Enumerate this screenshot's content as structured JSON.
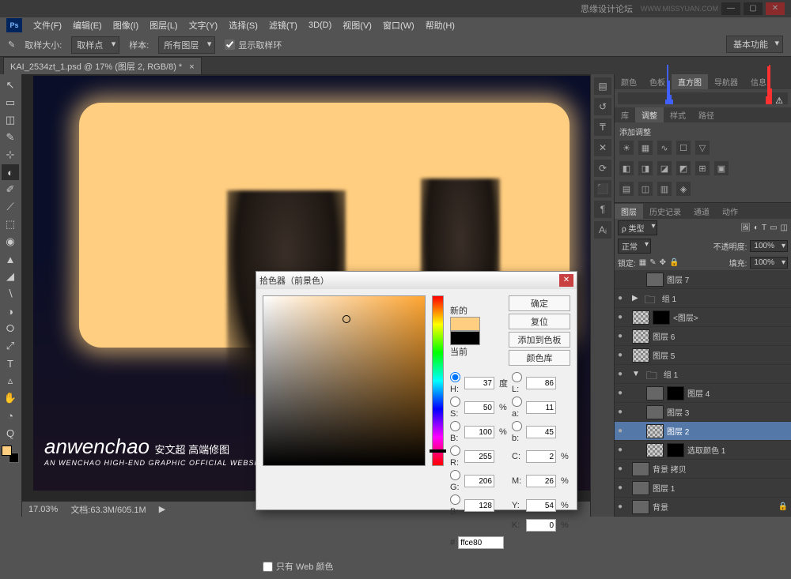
{
  "titlebar": {
    "brand": "思缘设计论坛",
    "url": "WWW.MISSYUAN.COM"
  },
  "menu": [
    "文件(F)",
    "编辑(E)",
    "图像(I)",
    "图层(L)",
    "文字(Y)",
    "选择(S)",
    "滤镜(T)",
    "3D(D)",
    "视图(V)",
    "窗口(W)",
    "帮助(H)"
  ],
  "options": {
    "sample_size_label": "取样大小:",
    "sample_size_value": "取样点",
    "sample_label": "样本:",
    "sample_value": "所有图层",
    "show_ring": "显示取样环"
  },
  "workspace": "基本功能",
  "doc_tab": "KAI_2534zt_1.psd @ 17% (图层 2, RGB/8) *",
  "status": {
    "zoom": "17.03%",
    "doc_info": "文档:63.3M/605.1M"
  },
  "watermark": {
    "big": "anwenchao",
    "cn": "安文超 高端修图",
    "sub": "AN WENCHAO HIGH-END GRAPHIC OFFICIAL WEBSITE/WWW.ANWENCHAO.COM"
  },
  "panels": {
    "tabs1": [
      "颜色",
      "色板",
      "直方图",
      "导航器",
      "信息"
    ],
    "tabs1_active": 2,
    "tabs2": [
      "库",
      "调整",
      "样式",
      "路径"
    ],
    "adjust_label": "添加调整",
    "tabs3": [
      "图层",
      "历史记录",
      "通道",
      "动作"
    ],
    "layer_kind": "ρ 类型",
    "blend_mode": "正常",
    "opacity_label": "不透明度:",
    "opacity_value": "100%",
    "lock_label": "锁定:",
    "fill_label": "填充:",
    "fill_value": "100%",
    "layers": [
      {
        "eye": "",
        "name": "图层 7",
        "indent": 1,
        "thumb": "img"
      },
      {
        "eye": "●",
        "name": "组 1",
        "indent": 0,
        "thumb": "folder",
        "arrow": "▶"
      },
      {
        "eye": "●",
        "name": "<图层>",
        "indent": 0,
        "thumb": "checker",
        "mask": true
      },
      {
        "eye": "●",
        "name": "图层 6",
        "indent": 0,
        "thumb": "checker"
      },
      {
        "eye": "●",
        "name": "图层 5",
        "indent": 0,
        "thumb": "checker"
      },
      {
        "eye": "●",
        "name": "组 1",
        "indent": 0,
        "thumb": "folder",
        "arrow": "▼"
      },
      {
        "eye": "●",
        "name": "图层 4",
        "indent": 1,
        "thumb": "img",
        "mask": true
      },
      {
        "eye": "●",
        "name": "图层 3",
        "indent": 1,
        "thumb": "img"
      },
      {
        "eye": "●",
        "name": "图层 2",
        "indent": 1,
        "thumb": "checker",
        "selected": true
      },
      {
        "eye": "●",
        "name": "选取颜色 1",
        "indent": 1,
        "thumb": "checker",
        "mask": true
      },
      {
        "eye": "●",
        "name": "背景 拷贝",
        "indent": 0,
        "thumb": "img"
      },
      {
        "eye": "●",
        "name": "图层 1",
        "indent": 0,
        "thumb": "img"
      },
      {
        "eye": "●",
        "name": "背景",
        "indent": 0,
        "thumb": "img",
        "lock": true
      }
    ]
  },
  "color_picker": {
    "title": "拾色器（前景色）",
    "new_label": "新的",
    "current_label": "当前",
    "ok": "确定",
    "cancel": "复位",
    "add_swatch": "添加到色板",
    "libraries": "颜色库",
    "web_only": "只有 Web 颜色",
    "H": "37",
    "H_u": "度",
    "S": "50",
    "S_u": "%",
    "B": "100",
    "B_u": "%",
    "L": "86",
    "a": "11",
    "b": "45",
    "R": "255",
    "G": "206",
    "Bc": "128",
    "C": "2",
    "C_u": "%",
    "M": "26",
    "M_u": "%",
    "Y": "54",
    "Y_u": "%",
    "K": "0",
    "K_u": "%",
    "hex": "ffce80",
    "new_color": "#ffce80",
    "cur_color": "#000000"
  },
  "tools": [
    "↖",
    "▭",
    "◫",
    "✎",
    "⊹",
    "◐",
    "✐",
    "⟋",
    "⬚",
    "◉",
    "▲",
    "◢",
    "∖",
    "◑",
    "⭘",
    "⤢",
    "T",
    "▵",
    "✋",
    "◔",
    "Q"
  ],
  "side_tools": [
    "▤",
    "↺",
    "₸",
    "✕",
    "⟳",
    "⬛",
    "¶",
    "Aᵢ"
  ]
}
